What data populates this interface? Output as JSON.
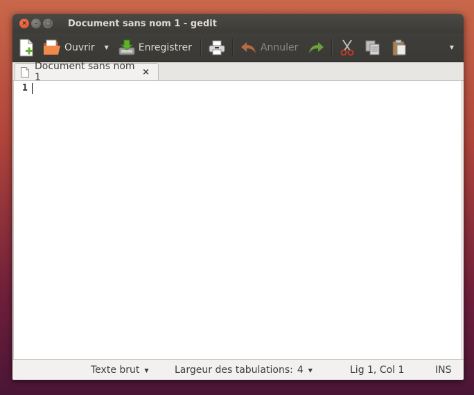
{
  "window": {
    "title": "Document sans nom 1 - gedit"
  },
  "toolbar": {
    "open_label": "Ouvrir",
    "save_label": "Enregistrer",
    "undo_label": "Annuler"
  },
  "tabs": [
    {
      "label": "Document sans nom 1",
      "close": "×"
    }
  ],
  "editor": {
    "line_number": "1"
  },
  "statusbar": {
    "language": "Texte brut",
    "tab_width_label": "Largeur des tabulations:",
    "tab_width_value": "4",
    "position": "Lig 1, Col 1",
    "mode": "INS"
  },
  "colors": {
    "accent_close": "#e05a2b",
    "toolbar_bg": "#3c3b37",
    "window_bg": "#f2f1f0"
  }
}
